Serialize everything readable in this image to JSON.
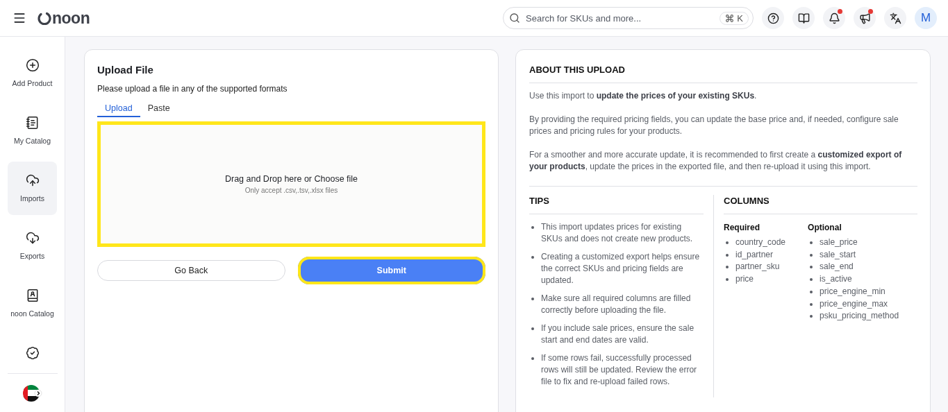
{
  "header": {
    "logo": "noon",
    "search": {
      "placeholder": "Search for SKUs and more..."
    },
    "shortcut_key": "K",
    "actions": [
      {
        "kind": "help",
        "badge": false
      },
      {
        "kind": "book",
        "badge": false
      },
      {
        "kind": "bell",
        "badge": true
      },
      {
        "kind": "megaphone",
        "badge": true
      },
      {
        "kind": "language",
        "badge": false
      }
    ],
    "avatar": "M"
  },
  "sidebar": {
    "items": [
      {
        "kind": "add",
        "label": "Add Product",
        "selected": false
      },
      {
        "kind": "catalog",
        "label": "My Catalog",
        "selected": false
      },
      {
        "kind": "upload",
        "label": "Imports",
        "selected": true
      },
      {
        "kind": "download",
        "label": "Exports",
        "selected": false
      },
      {
        "kind": "noon-catalog",
        "label": "noon Catalog",
        "selected": false
      },
      {
        "kind": "badge",
        "selected": false
      }
    ]
  },
  "upload": {
    "title": "Upload File",
    "subtitle": "Please upload a file in any of the supported formats",
    "tabs": [
      {
        "label": "Upload",
        "selected": true
      },
      {
        "label": "Paste",
        "selected": false
      }
    ],
    "dropzone": {
      "text": "Drag and Drop here or Choose file",
      "hint": "Only accept .csv,.tsv,.xlsx files",
      "highlighted": true
    },
    "buttons": [
      {
        "label": "Go Back",
        "kind": "secondary",
        "highlighted": false
      },
      {
        "label": "Submit",
        "kind": "primary",
        "highlighted": true
      }
    ]
  },
  "about": {
    "title": "ABOUT THIS UPLOAD",
    "paragraphs": [
      "Use this import to **update the prices of your existing SKUs**.",
      "By providing the required pricing fields, you can update the base price and, if needed, configure sale prices and pricing rules for your products.",
      "For a smoother and more accurate update, it is recommended to first create a **customized export of your products**, update the prices in the exported file, and then re-upload it using this import."
    ],
    "tips": {
      "title": "TIPS",
      "items": [
        "This import updates prices for existing SKUs and does not create new products.",
        "Creating a customized export helps ensure the correct SKUs and pricing fields are updated.",
        "Make sure all required columns are filled correctly before uploading the file.",
        "If you include sale prices, ensure the sale start and end dates are valid.",
        "If some rows fail, successfully processed rows will still be updated. Review the error file to fix and re-upload failed rows."
      ]
    },
    "columns": {
      "title": "COLUMNS",
      "groups": [
        {
          "title": "Required",
          "items": [
            "country_code",
            "id_partner",
            "partner_sku",
            "price"
          ]
        },
        {
          "title": "Optional",
          "items": [
            "sale_price",
            "sale_start",
            "sale_end",
            "is_active",
            "price_engine_min",
            "price_engine_max",
            "psku_pricing_method"
          ]
        }
      ]
    }
  }
}
